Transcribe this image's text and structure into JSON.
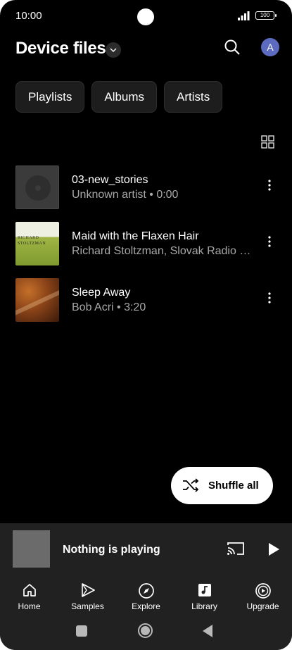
{
  "status_bar": {
    "time": "10:00",
    "battery": "100"
  },
  "header": {
    "title": "Device files",
    "avatar_letter": "A"
  },
  "chips": [
    {
      "label": "Playlists"
    },
    {
      "label": "Albums"
    },
    {
      "label": "Artists"
    }
  ],
  "tracks": [
    {
      "title": "03-new_stories",
      "subtitle": "Unknown artist • 0:00",
      "art": "disc-placeholder"
    },
    {
      "title": "Maid with the Flaxen Hair",
      "subtitle": "Richard Stoltzman, Slovak Radio Sy...",
      "art": "album-richard-stoltzman",
      "art_text_1": "RICHARD",
      "art_text_2": "STOLTZMAN"
    },
    {
      "title": "Sleep Away",
      "subtitle": "Bob Acri • 3:20",
      "art": "album-brown"
    }
  ],
  "shuffle": {
    "label": "Shuffle all"
  },
  "player": {
    "status": "Nothing is playing"
  },
  "nav": [
    {
      "label": "Home",
      "icon": "home-icon"
    },
    {
      "label": "Samples",
      "icon": "samples-icon"
    },
    {
      "label": "Explore",
      "icon": "compass-icon"
    },
    {
      "label": "Library",
      "icon": "library-icon"
    },
    {
      "label": "Upgrade",
      "icon": "upgrade-icon"
    }
  ],
  "colors": {
    "background": "#000000",
    "surface": "#212121",
    "chip": "#1d1d1d",
    "secondary_text": "#a8a8a8",
    "avatar": "#5c6bc0"
  }
}
